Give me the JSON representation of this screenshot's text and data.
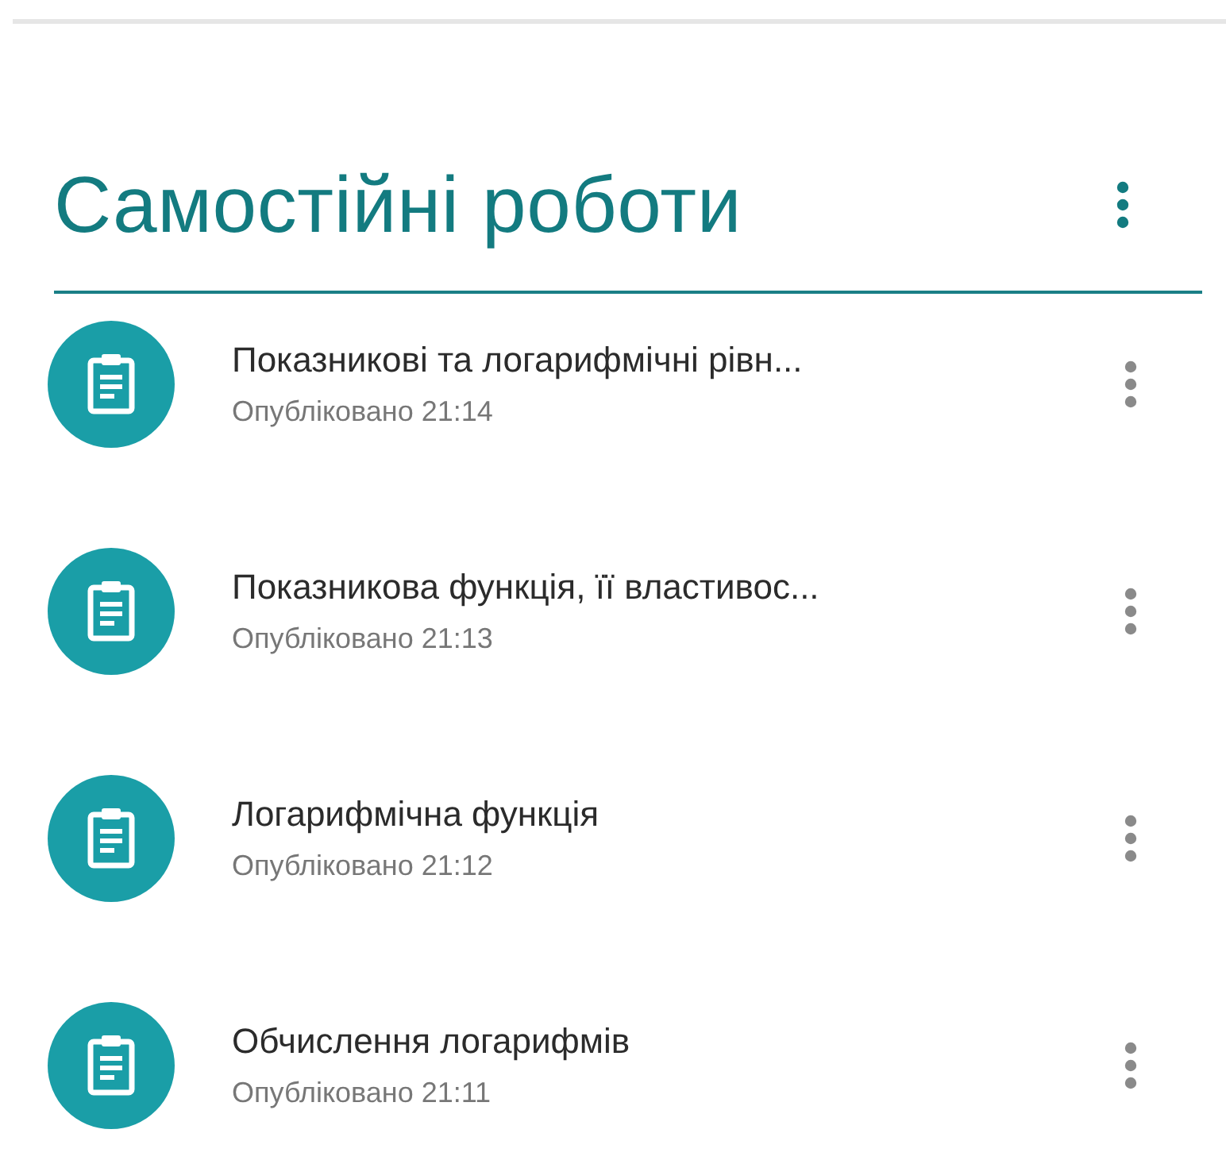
{
  "topic": {
    "title": "Самостійні роботи"
  },
  "assignments": [
    {
      "title": "Показникові та логарифмічні рівн...",
      "status": "Опубліковано 21:14"
    },
    {
      "title": "Показникова функція, її властивос...",
      "status": "Опубліковано 21:13"
    },
    {
      "title": "Логарифмічна функція",
      "status": "Опубліковано 21:12"
    },
    {
      "title": "Обчислення логарифмів",
      "status": "Опубліковано 21:11"
    }
  ]
}
